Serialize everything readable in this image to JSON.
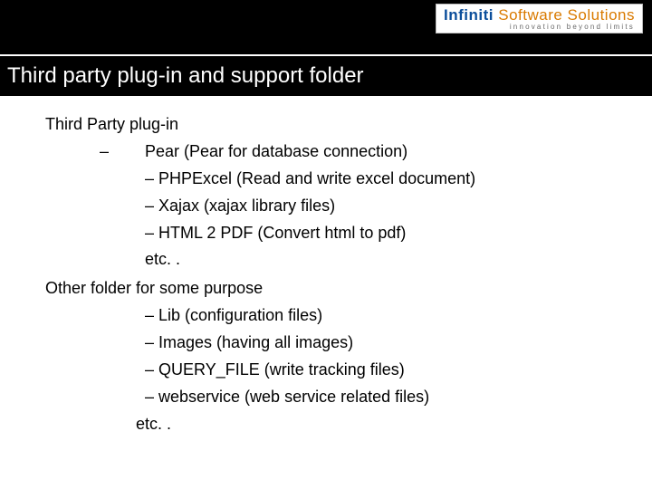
{
  "logo": {
    "brand1": "Infiniti",
    "brand2": "Software Solutions",
    "tagline": "innovation beyond limits"
  },
  "title": "Third party plug-in and support folder",
  "section1": {
    "heading": "Third Party plug-in",
    "first_bullet_lead": "–",
    "first_bullet": "Pear  (Pear for database connection)",
    "items": [
      "PHPExcel (Read and write excel document)",
      "Xajax  (xajax library files)",
      "HTML 2 PDF (Convert html to pdf)"
    ],
    "etc": "etc. ."
  },
  "section2": {
    "heading": "Other folder for some purpose",
    "items": [
      "Lib (configuration files)",
      "Images (having all images)",
      "QUERY_FILE (write tracking files)",
      "webservice (web service related files)"
    ],
    "etc": "etc. ."
  }
}
